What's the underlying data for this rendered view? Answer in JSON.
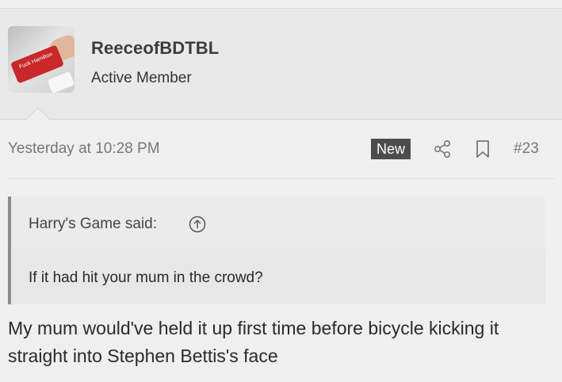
{
  "user": {
    "name": "ReeceofBDTBL",
    "title": "Active Member",
    "avatar_key_text": "Fuck Hamilton"
  },
  "post": {
    "timestamp": "Yesterday at 10:28 PM",
    "new_badge": "New",
    "number": "#23",
    "body": "My mum would've held it up first time before bicycle kicking it straight into Stephen Bettis's face"
  },
  "quote": {
    "author": "Harry's Game said:",
    "text": "If it had hit your mum in the crowd?"
  },
  "icons": {
    "share": "share-icon",
    "bookmark": "bookmark-icon",
    "quote_jump": "arrow-up-circle-icon"
  },
  "colors": {
    "badge_bg": "#4d4d4d",
    "quote_border": "#8c8c8c"
  }
}
